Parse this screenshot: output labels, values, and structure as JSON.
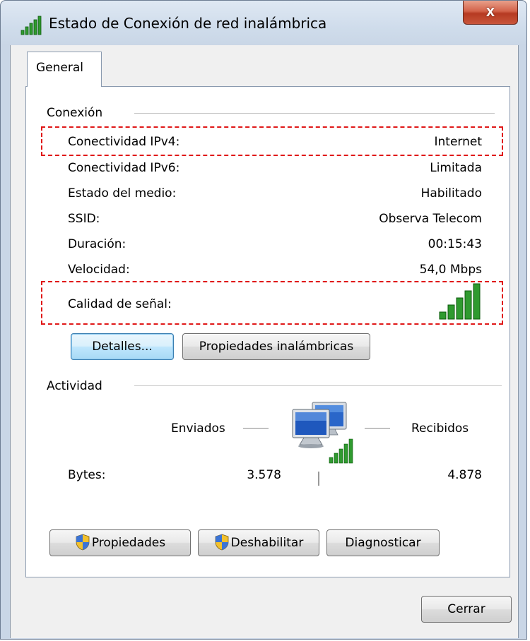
{
  "window": {
    "title": "Estado de Conexión de red inalámbrica",
    "close_label": "x"
  },
  "tabs": [
    {
      "label": "General"
    }
  ],
  "connection": {
    "group_label": "Conexión",
    "rows": [
      {
        "label": "Conectividad IPv4:",
        "value": "Internet"
      },
      {
        "label": "Conectividad IPv6:",
        "value": "Limitada"
      },
      {
        "label": "Estado del medio:",
        "value": "Habilitado"
      },
      {
        "label": "SSID:",
        "value": "Observa Telecom"
      },
      {
        "label": "Duración:",
        "value": "00:15:43"
      },
      {
        "label": "Velocidad:",
        "value": "54,0 Mbps"
      },
      {
        "label": "Calidad de señal:",
        "value": ""
      }
    ],
    "signal_bars": 5,
    "signal_max": 5
  },
  "buttons": {
    "details": "Detalles...",
    "wireless_properties": "Propiedades inalámbricas"
  },
  "activity": {
    "group_label": "Actividad",
    "sent_label": "Enviados",
    "received_label": "Recibidos",
    "bytes_label": "Bytes:",
    "bytes_sent": "3.578",
    "bytes_received": "4.878"
  },
  "bottom_buttons": {
    "properties": "Propiedades",
    "disable": "Deshabilitar",
    "diagnose": "Diagnosticar"
  },
  "footer": {
    "close": "Cerrar"
  },
  "colors": {
    "signal_green": "#2f9a2f",
    "highlight_red": "#e01818",
    "focus_blue": "#3c7fb1"
  },
  "icons": {
    "title": "signal-bars-icon",
    "shield": "uac-shield-icon",
    "network": "computers-network-icon"
  }
}
